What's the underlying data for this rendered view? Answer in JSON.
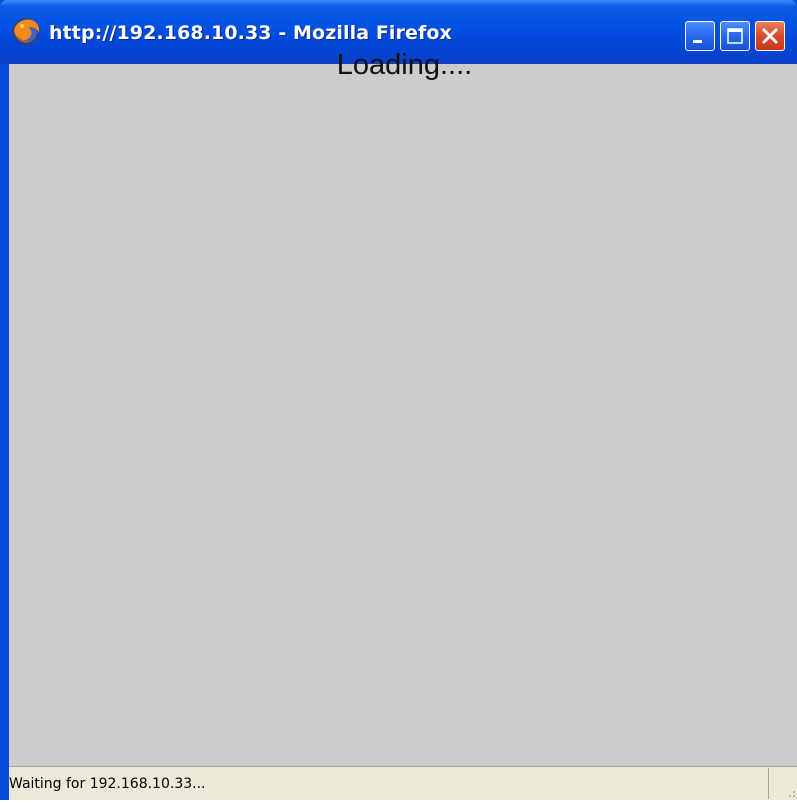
{
  "window": {
    "title": "http://192.168.10.33 - Mozilla Firefox",
    "app_icon": "firefox-icon",
    "controls": {
      "minimize_icon": "minimize-icon",
      "maximize_icon": "maximize-icon",
      "close_icon": "close-icon"
    }
  },
  "content": {
    "message": "Loading....",
    "background_color": "#cccccc"
  },
  "statusbar": {
    "text": "Waiting for 192.168.10.33...",
    "resize_icon": "resize-grip-icon"
  },
  "colors": {
    "titlebar_blue": "#0452e2",
    "close_red": "#d6492b",
    "statusbar_bg": "#ece9d8"
  }
}
